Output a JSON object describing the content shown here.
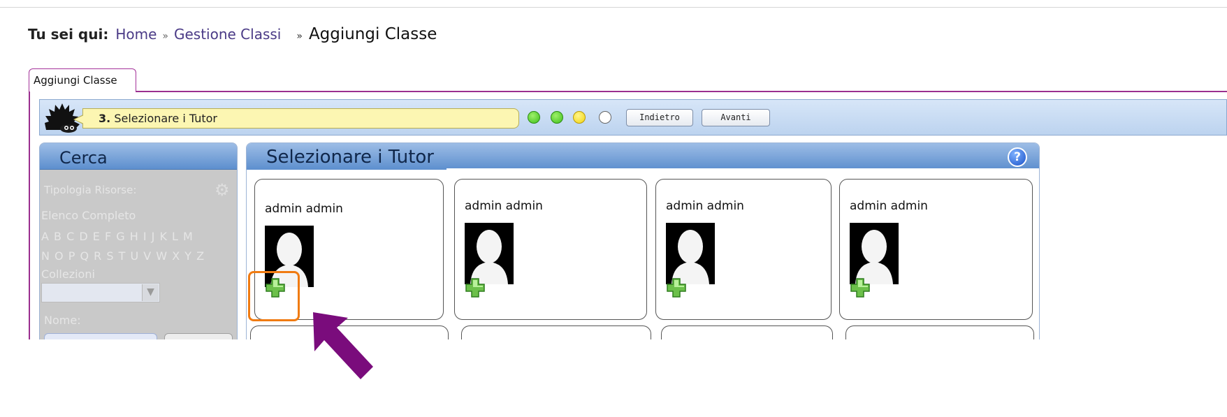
{
  "breadcrumb": {
    "prefix": "Tu sei qui:",
    "home": "Home",
    "sep1": "»",
    "section": "Gestione Classi",
    "sep2": "»",
    "current": "Aggiungi Classe"
  },
  "tab": {
    "label": "Aggiungi Classe"
  },
  "wizard": {
    "step_number": "3.",
    "step_label": "Selezionare i Tutor",
    "progress": [
      "done",
      "done",
      "current",
      "todo"
    ],
    "back_label": "Indietro",
    "next_label": "Avanti"
  },
  "search": {
    "title": "Cerca",
    "resource_type_label": "Tipologia Risorse:",
    "full_list_label": "Elenco Completo",
    "alphabet_row1": "A B C D E F G H I J  K L M",
    "alphabet_row2": "N O P Q R S T U V W X Y Z",
    "collections_label": "Collezioni",
    "collections_value": "",
    "name_label": "Nome:",
    "name_value": ""
  },
  "tutors": {
    "title": "Selezionare i Tutor",
    "cards": [
      {
        "name": "admin admin"
      },
      {
        "name": "admin admin"
      },
      {
        "name": "admin admin"
      },
      {
        "name": "admin admin"
      }
    ]
  },
  "colors": {
    "accent_purple": "#9a2f8f",
    "panel_header_blue": "#5d8fce",
    "highlight_orange": "#f07b12",
    "arrow_purple": "#7a0c7c"
  }
}
